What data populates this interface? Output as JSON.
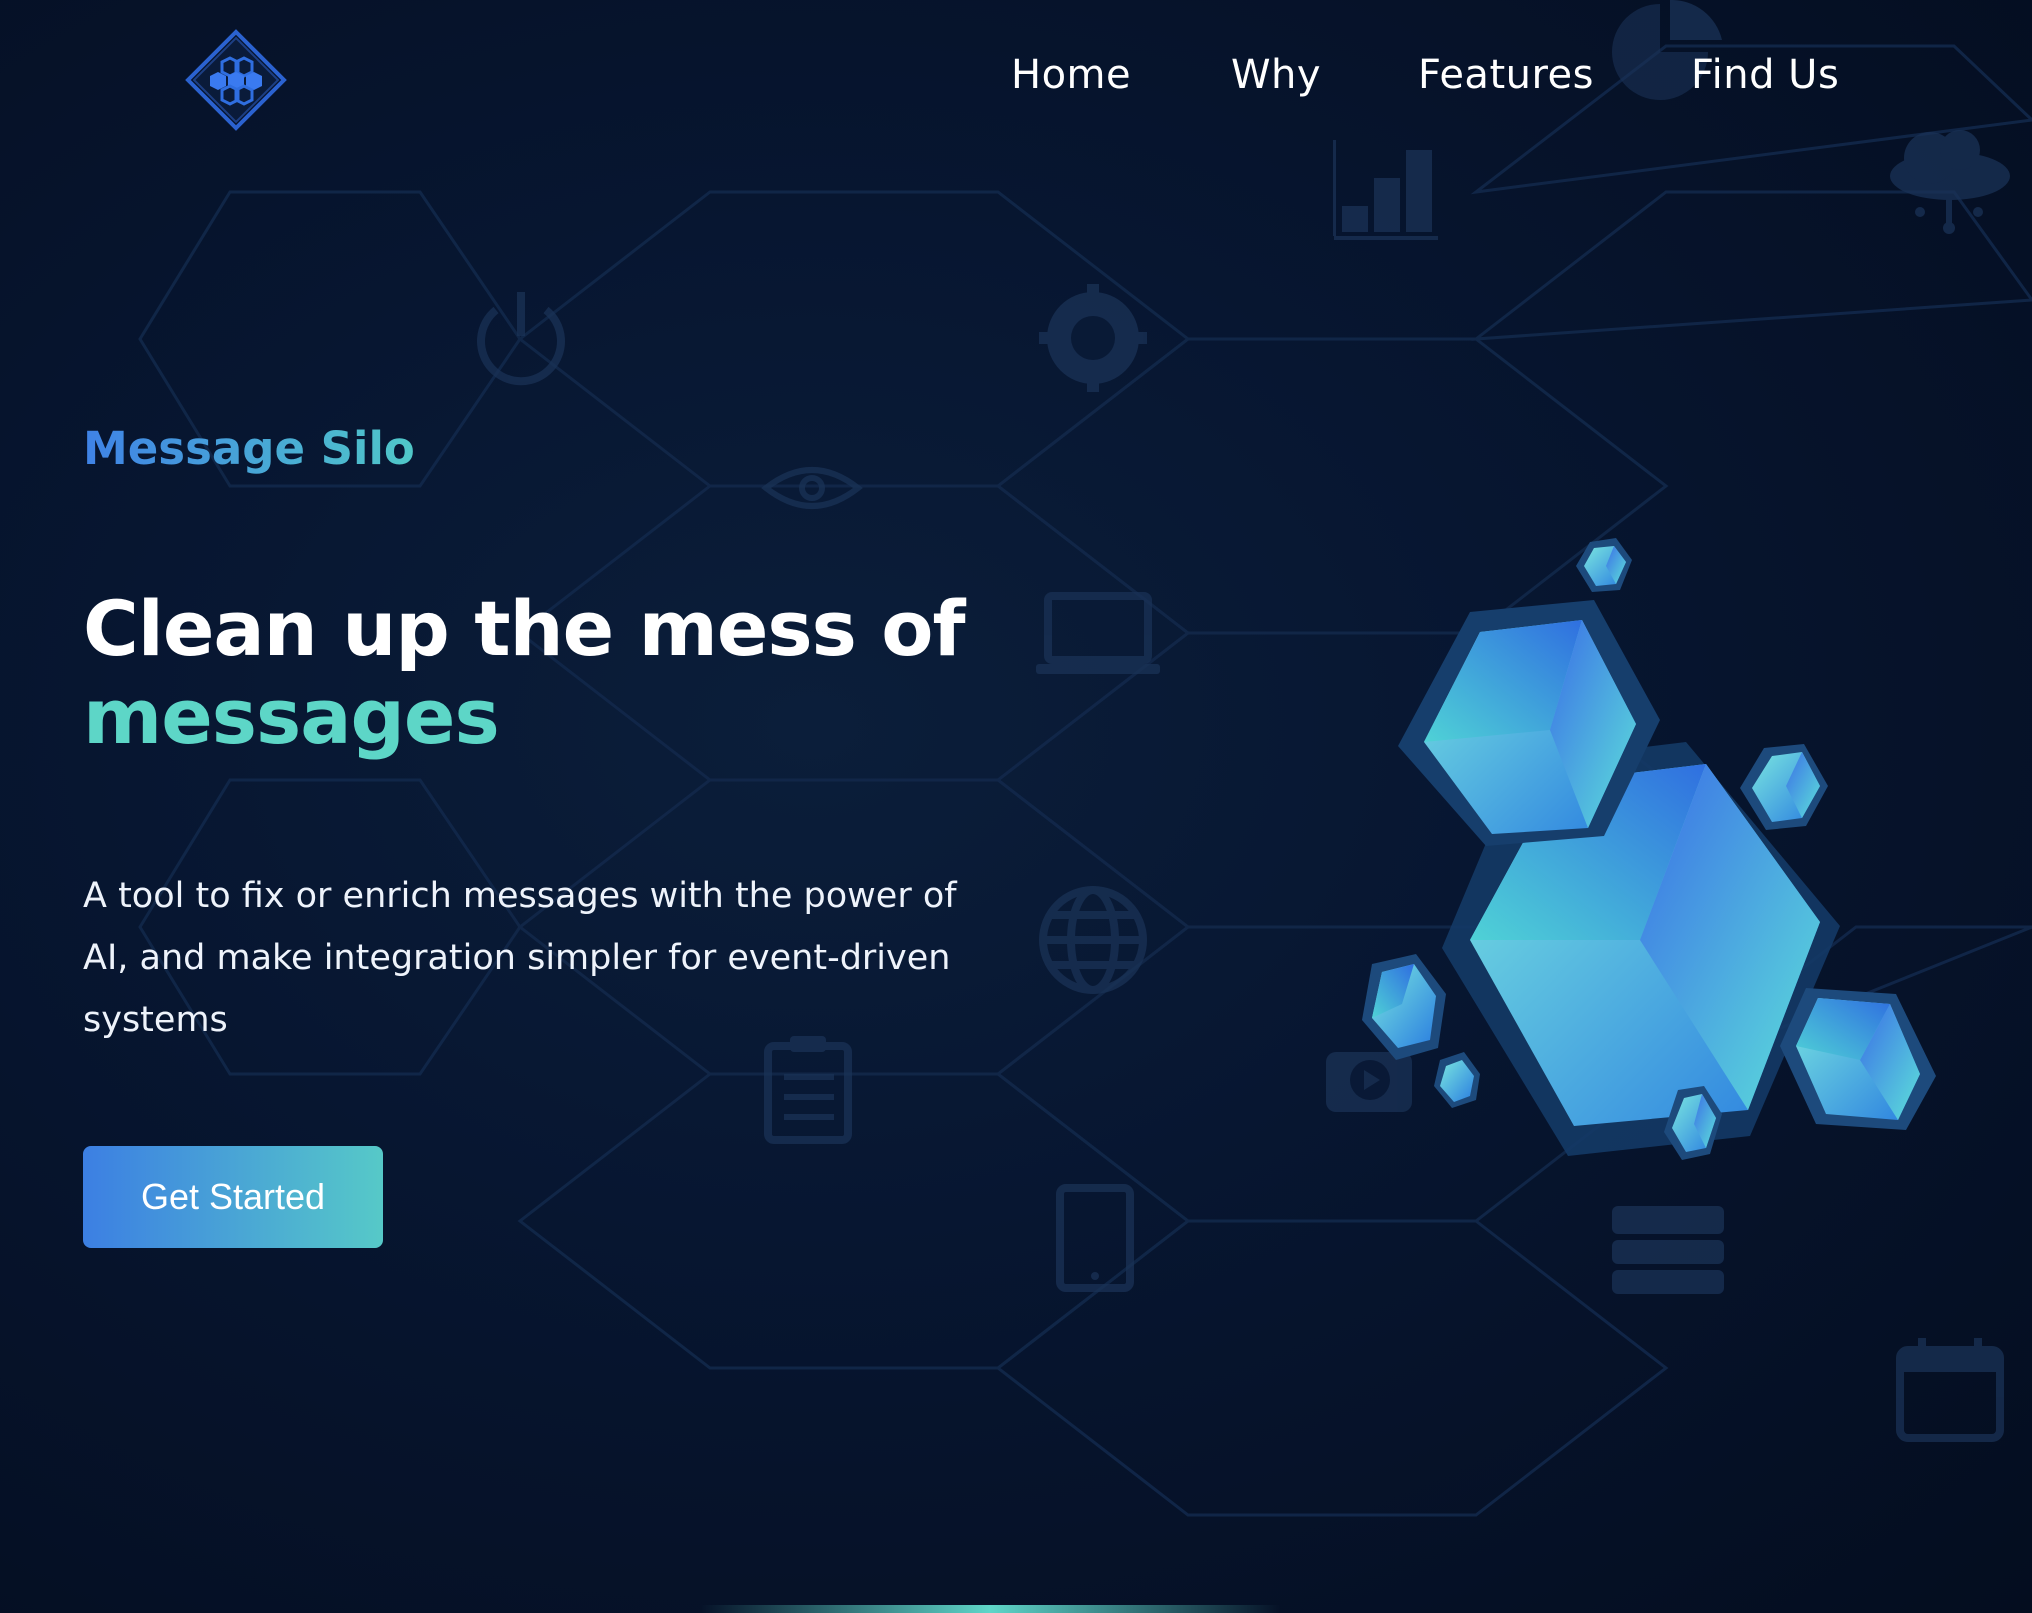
{
  "nav": {
    "items": [
      {
        "label": "Home"
      },
      {
        "label": "Why"
      },
      {
        "label": "Features"
      },
      {
        "label": "Find Us"
      }
    ]
  },
  "hero": {
    "brand": "Message Silo",
    "headline_line1": "Clean up the mess of",
    "headline_line2": "messages",
    "subtitle": "A tool to fix or enrich messages with the power of AI, and make integration simpler for event-driven systems",
    "cta_label": "Get Started"
  },
  "colors": {
    "background": "#071631",
    "accent_blue": "#3c7fe3",
    "accent_teal": "#5dd6c7",
    "text": "#ffffff"
  },
  "icons": [
    "logo-hexagon-icon",
    "bar-chart-icon",
    "cloud-network-icon",
    "power-icon",
    "gear-icon",
    "eye-icon",
    "laptop-icon",
    "globe-icon",
    "clipboard-icon",
    "video-chat-icon",
    "tablet-icon",
    "server-icon",
    "calendar-icon",
    "pie-chart-icon"
  ]
}
